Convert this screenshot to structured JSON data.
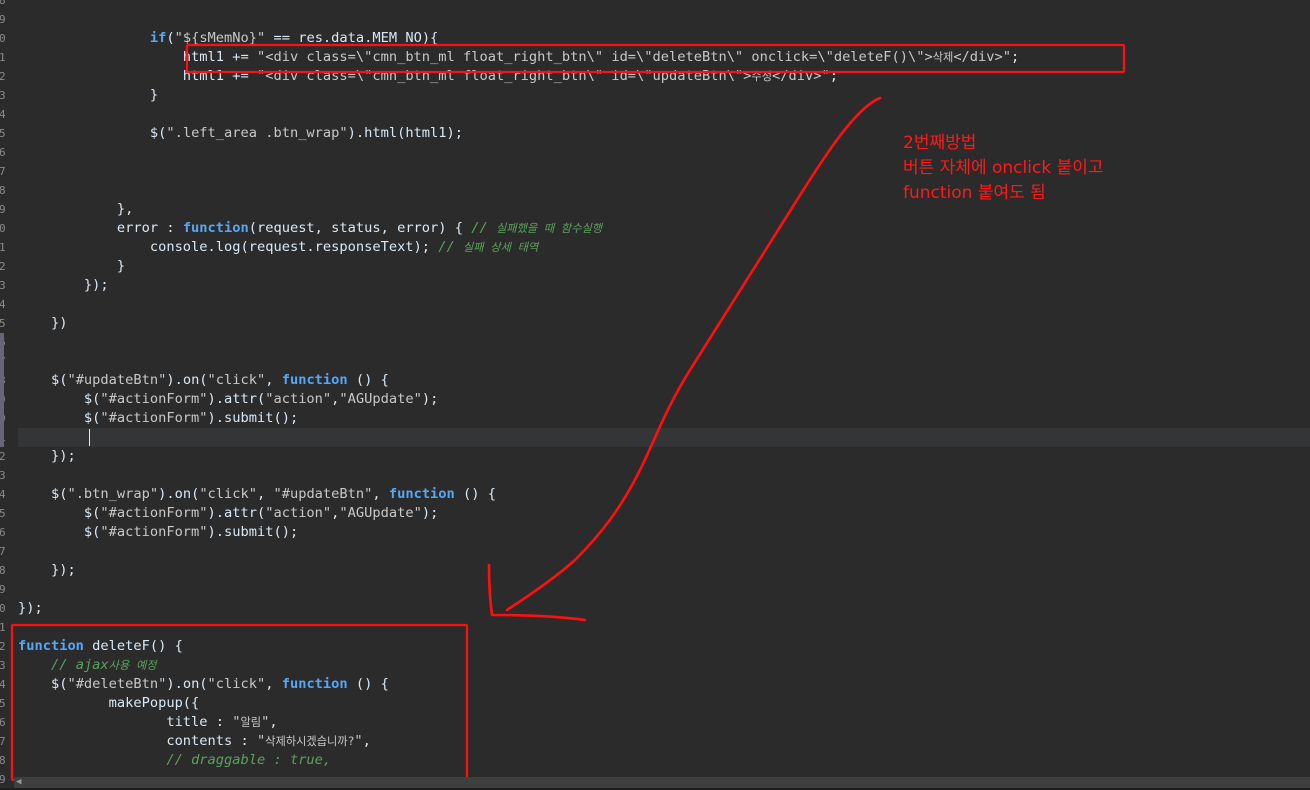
{
  "editor": {
    "code_lines": [
      [
        {
          "t": "                "
        },
        {
          "t": "if",
          "c": "kw"
        },
        {
          "t": "("
        },
        {
          "t": "\"${sMemNo}\"",
          "c": "s"
        },
        {
          "t": " == res.data.MEM_NO){"
        }
      ],
      [
        {
          "t": "                    html1 += "
        },
        {
          "t": "\"<div class=\\\"cmn_btn_ml float_right_btn\\\" id=\\\"deleteBtn\\\" onclick=\\\"deleteF()\\\">",
          "c": "s"
        },
        {
          "t": "삭제",
          "c": "s k"
        },
        {
          "t": "</div>\"",
          "c": "s"
        },
        {
          "t": ";"
        }
      ],
      [
        {
          "t": "                    html1 += "
        },
        {
          "t": "\"<div class=\\\"cmn_btn_ml float_right_btn\\\" id=\\\"updateBtn\\\">",
          "c": "s"
        },
        {
          "t": "수정",
          "c": "s k"
        },
        {
          "t": "</div>\"",
          "c": "s"
        },
        {
          "t": ";"
        }
      ],
      [
        {
          "t": "                }"
        }
      ],
      [
        {
          "t": ""
        }
      ],
      [
        {
          "t": "                $("
        },
        {
          "t": "\".left_area .btn_wrap\"",
          "c": "s"
        },
        {
          "t": ").html(html1);"
        }
      ],
      [
        {
          "t": ""
        }
      ],
      [
        {
          "t": ""
        }
      ],
      [
        {
          "t": ""
        }
      ],
      [
        {
          "t": "            },"
        }
      ],
      [
        {
          "t": "            error : "
        },
        {
          "t": "function",
          "c": "kw"
        },
        {
          "t": "(request, status, error) { "
        },
        {
          "t": "// ",
          "c": "c"
        },
        {
          "t": "실패했을 때 함수실행",
          "c": "c k"
        }
      ],
      [
        {
          "t": "                console.log(request.responseText); "
        },
        {
          "t": "// ",
          "c": "c"
        },
        {
          "t": "실패 상세 태역",
          "c": "c k"
        }
      ],
      [
        {
          "t": "            }"
        }
      ],
      [
        {
          "t": "        });"
        }
      ],
      [
        {
          "t": ""
        }
      ],
      [
        {
          "t": "    })"
        }
      ],
      [
        {
          "t": ""
        }
      ],
      [
        {
          "t": ""
        }
      ],
      [
        {
          "t": "    $("
        },
        {
          "t": "\"#updateBtn\"",
          "c": "s"
        },
        {
          "t": ").on("
        },
        {
          "t": "\"click\"",
          "c": "s"
        },
        {
          "t": ", "
        },
        {
          "t": "function",
          "c": "kw"
        },
        {
          "t": " () {"
        }
      ],
      [
        {
          "t": "        $("
        },
        {
          "t": "\"#actionForm\"",
          "c": "s"
        },
        {
          "t": ").attr("
        },
        {
          "t": "\"action\"",
          "c": "s"
        },
        {
          "t": ","
        },
        {
          "t": "\"AGUpdate\"",
          "c": "s"
        },
        {
          "t": ");"
        }
      ],
      [
        {
          "t": "        $("
        },
        {
          "t": "\"#actionForm\"",
          "c": "s"
        },
        {
          "t": ").submit();"
        }
      ],
      [
        {
          "t": ""
        }
      ],
      [
        {
          "t": "    });"
        }
      ],
      [
        {
          "t": ""
        }
      ],
      [
        {
          "t": "    $("
        },
        {
          "t": "\".btn_wrap\"",
          "c": "s"
        },
        {
          "t": ").on("
        },
        {
          "t": "\"click\"",
          "c": "s"
        },
        {
          "t": ", "
        },
        {
          "t": "\"#updateBtn\"",
          "c": "s"
        },
        {
          "t": ", "
        },
        {
          "t": "function",
          "c": "kw"
        },
        {
          "t": " () {"
        }
      ],
      [
        {
          "t": "        $("
        },
        {
          "t": "\"#actionForm\"",
          "c": "s"
        },
        {
          "t": ").attr("
        },
        {
          "t": "\"action\"",
          "c": "s"
        },
        {
          "t": ","
        },
        {
          "t": "\"AGUpdate\"",
          "c": "s"
        },
        {
          "t": ");"
        }
      ],
      [
        {
          "t": "        $("
        },
        {
          "t": "\"#actionForm\"",
          "c": "s"
        },
        {
          "t": ").submit();"
        }
      ],
      [
        {
          "t": ""
        }
      ],
      [
        {
          "t": "    });"
        }
      ],
      [
        {
          "t": ""
        }
      ],
      [
        {
          "t": "});"
        }
      ],
      [
        {
          "t": ""
        }
      ],
      [
        {
          "t": "function",
          "c": "kw"
        },
        {
          "t": " deleteF() {"
        }
      ],
      [
        {
          "t": "    "
        },
        {
          "t": "// ajax",
          "c": "c"
        },
        {
          "t": "사용 예정",
          "c": "c k"
        }
      ],
      [
        {
          "t": "    $("
        },
        {
          "t": "\"#deleteBtn\"",
          "c": "s"
        },
        {
          "t": ").on("
        },
        {
          "t": "\"click\"",
          "c": "s"
        },
        {
          "t": ", "
        },
        {
          "t": "function",
          "c": "kw"
        },
        {
          "t": " () {"
        }
      ],
      [
        {
          "t": "           makePopup({"
        }
      ],
      [
        {
          "t": "                  title : "
        },
        {
          "t": "\"",
          "c": "s"
        },
        {
          "t": "알림",
          "c": "s k"
        },
        {
          "t": "\"",
          "c": "s"
        },
        {
          "t": ","
        }
      ],
      [
        {
          "t": "                  contents : "
        },
        {
          "t": "\"",
          "c": "s"
        },
        {
          "t": "삭제하시겠습니까?",
          "c": "s k"
        },
        {
          "t": "\"",
          "c": "s"
        },
        {
          "t": ","
        }
      ],
      [
        {
          "t": "                  "
        },
        {
          "t": "// draggable : true,",
          "c": "c"
        }
      ]
    ],
    "gutter_digits": [
      "8",
      "9",
      "0",
      "1",
      "2",
      "3",
      "4",
      "5",
      "6",
      "7",
      "8",
      "9",
      "0",
      "1",
      "2",
      "3",
      "4",
      "5",
      "6",
      "7",
      "8",
      "9",
      "0",
      "1",
      "2",
      "3",
      "4",
      "5",
      "6",
      "7",
      "8",
      "9",
      "0",
      "1",
      "2",
      "3",
      "4",
      "5",
      "6",
      "7",
      "8",
      "9"
    ]
  },
  "annotation": {
    "lines": [
      "2번째방법",
      "버튼 자체에 onclick 붙이고",
      "function 붙여도 됨"
    ],
    "color": "#ff1a1a"
  },
  "scrollbar": {
    "left_arrow": "◀"
  }
}
